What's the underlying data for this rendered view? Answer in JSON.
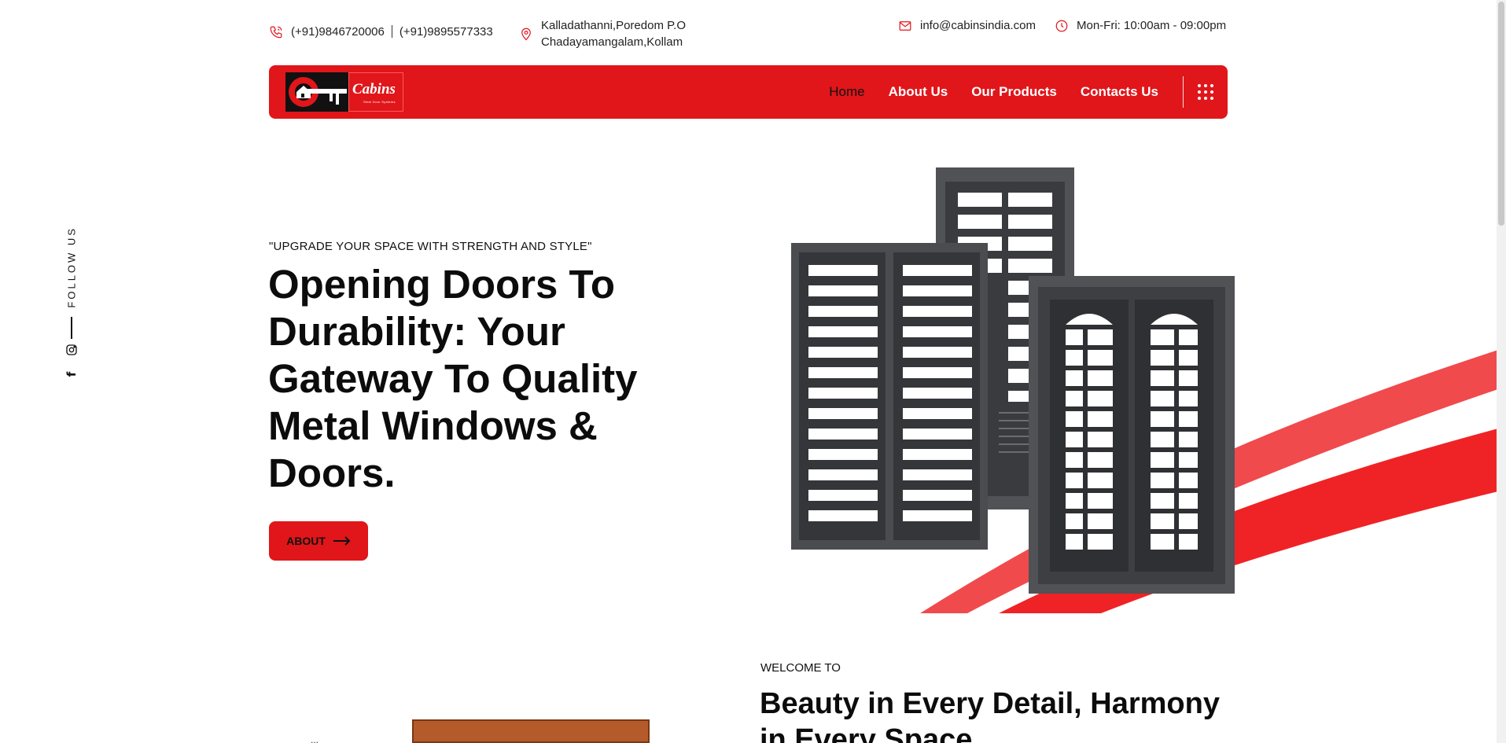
{
  "topbar": {
    "phone1": "(+91)9846720006",
    "phone2": "(+91)9895577333",
    "address_line1": "Kalladathanni,Poredom P.O",
    "address_line2": "Chadayamangalam,Kollam",
    "email": "info@cabinsindia.com",
    "hours": "Mon-Fri: 10:00am - 09:00pm"
  },
  "logo": {
    "word": "Cabins",
    "sub": "Steel Door Systems"
  },
  "nav": {
    "items": [
      {
        "label": "Home"
      },
      {
        "label": "About Us"
      },
      {
        "label": "Our Products"
      },
      {
        "label": "Contacts Us"
      }
    ]
  },
  "side": {
    "follow_label": "FOLLOW US"
  },
  "hero": {
    "tagline": "\"UPGRADE YOUR SPACE WITH STRENGTH AND STYLE\"",
    "title": "Opening Doors To Durability: Your Gateway To Quality Metal Windows & Doors.",
    "button_label": "ABOUT"
  },
  "welcome": {
    "label": "WELCOME TO",
    "title": "Beauty in Every Detail, Harmony in Every Space"
  },
  "colors": {
    "brand_red": "#e0161a",
    "text_dark": "#111111"
  }
}
